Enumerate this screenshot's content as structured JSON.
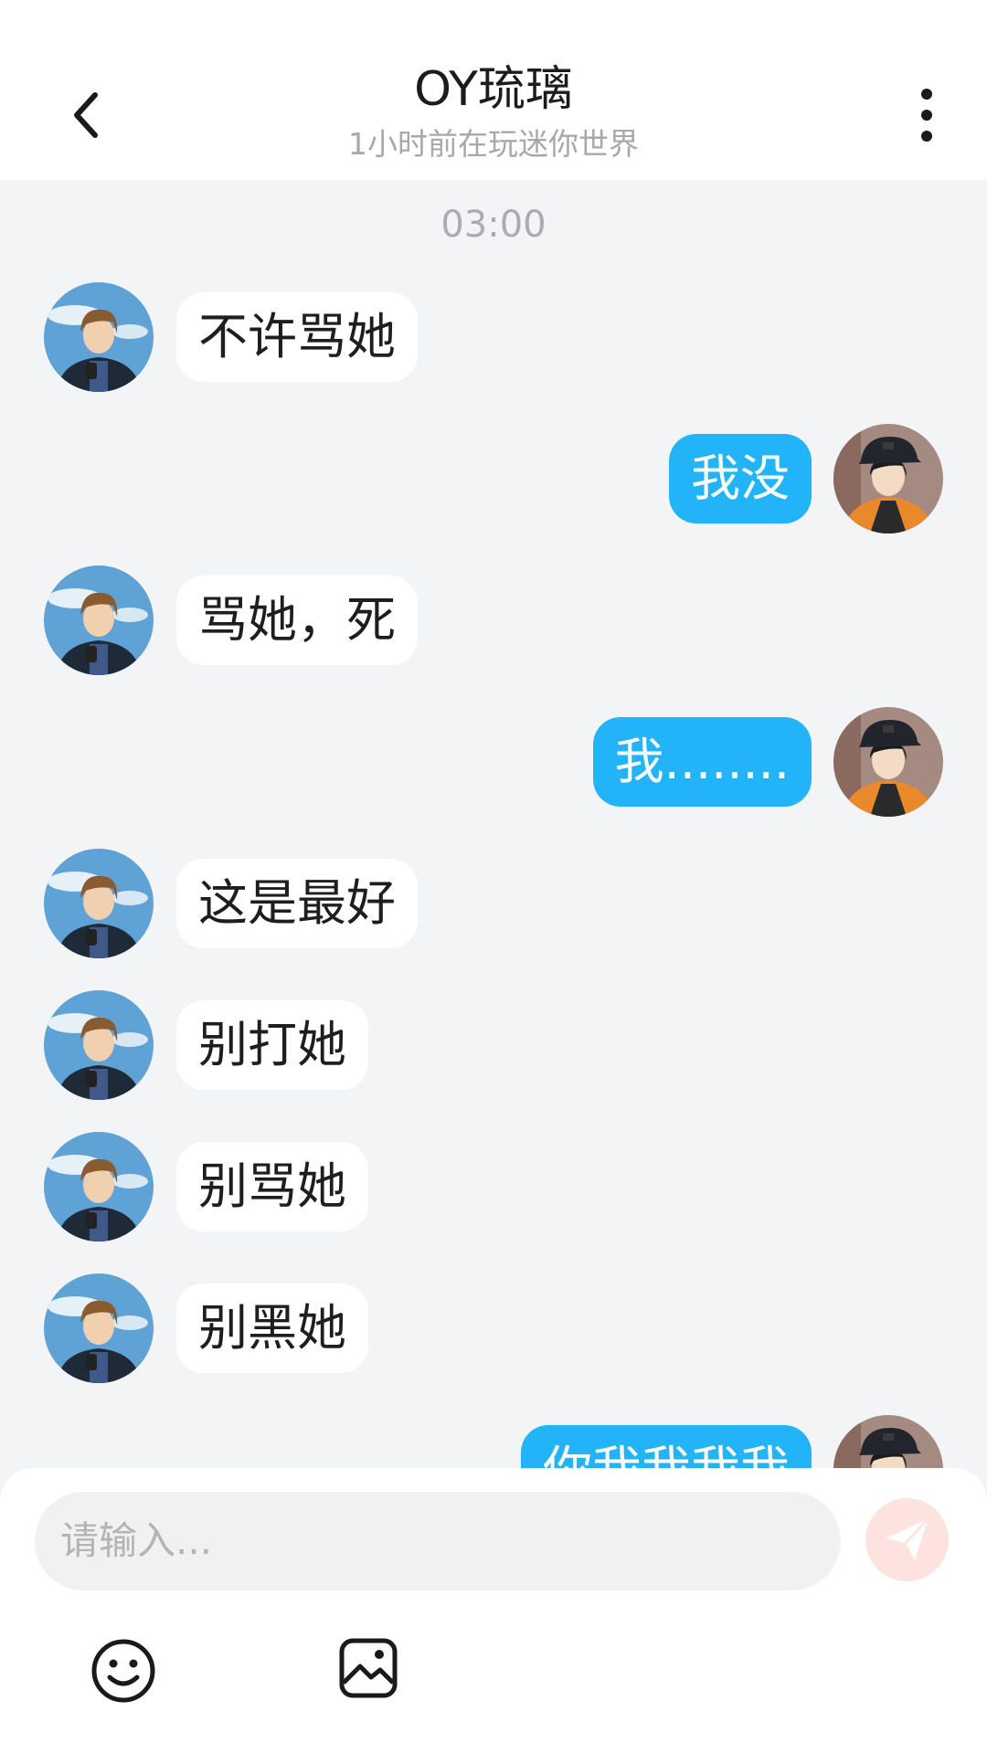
{
  "header": {
    "title": "OY琉璃",
    "subtitle": "1小时前在玩迷你世界",
    "back_icon": "chevron-left-icon",
    "more_icon": "vertical-ellipsis-icon"
  },
  "chat": {
    "timestamp": "03:00",
    "messages": [
      {
        "side": "left",
        "text": "不许骂她"
      },
      {
        "side": "right",
        "text": "我没"
      },
      {
        "side": "left",
        "text": "骂她，死"
      },
      {
        "side": "right",
        "text": "我........"
      },
      {
        "side": "left",
        "text": "这是最好"
      },
      {
        "side": "left",
        "text": "别打她"
      },
      {
        "side": "left",
        "text": "别骂她"
      },
      {
        "side": "left",
        "text": "别黑她"
      },
      {
        "side": "right",
        "text": "你我我我我"
      }
    ]
  },
  "composer": {
    "placeholder": "请输入...",
    "send_icon": "paper-plane-icon",
    "emoji_icon": "smiley-icon",
    "image_icon": "image-icon"
  },
  "colors": {
    "outgoing_bubble": "#22b4f6",
    "incoming_bubble": "#ffffff",
    "background": "#f3f4f6",
    "send_button": "#fde3df"
  }
}
